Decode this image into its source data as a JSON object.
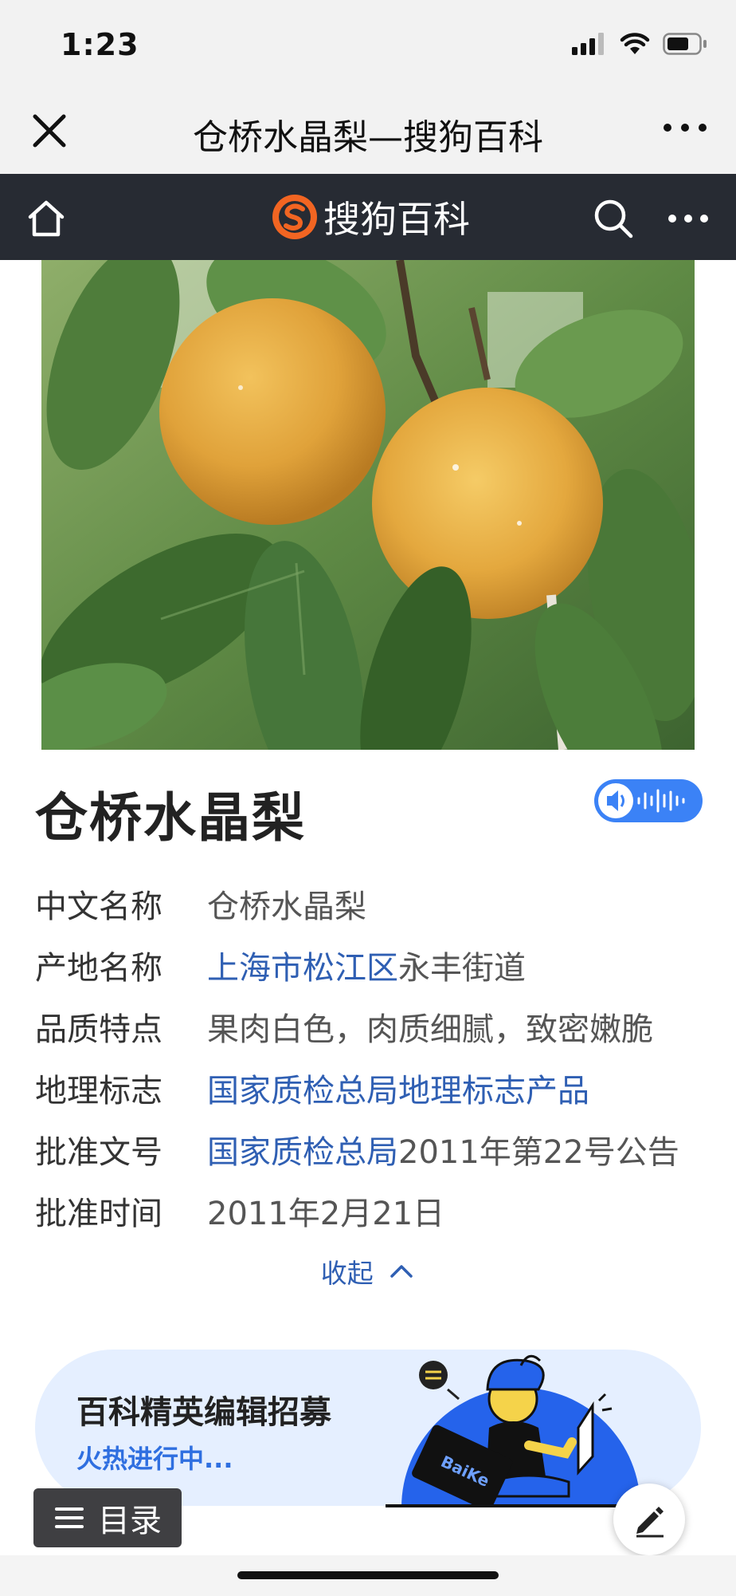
{
  "status_bar": {
    "time": "1:23",
    "icons": [
      "signal-icon",
      "wifi-icon",
      "battery-icon"
    ]
  },
  "wechat_bar": {
    "title": "仓桥水晶梨—搜狗百科",
    "icons": [
      "close-icon",
      "more-icon"
    ]
  },
  "site_nav": {
    "brand": "搜狗百科",
    "icons": [
      "home-icon",
      "sogou-logo-icon",
      "search-icon",
      "more-icon"
    ]
  },
  "entry": {
    "title": "仓桥水晶梨",
    "info": [
      {
        "key": "中文名称",
        "parts": [
          {
            "text": "仓桥水晶梨",
            "link": false
          }
        ]
      },
      {
        "key": "产地名称",
        "parts": [
          {
            "text": "上海市松江区",
            "link": true
          },
          {
            "text": "永丰街道",
            "link": false
          }
        ]
      },
      {
        "key": "品质特点",
        "parts": [
          {
            "text": "果肉白色，肉质细腻，致密嫩脆",
            "link": false
          }
        ]
      },
      {
        "key": "地理标志",
        "parts": [
          {
            "text": "国家质检总局地理标志产品",
            "link": true
          }
        ]
      },
      {
        "key": "批准文号",
        "parts": [
          {
            "text": "国家质检总局",
            "link": true
          },
          {
            "text": "2011年第22号公告",
            "link": false
          }
        ]
      },
      {
        "key": "批准时间",
        "parts": [
          {
            "text": "2011年2月21日",
            "link": false
          }
        ]
      }
    ],
    "collapse_label": "收起"
  },
  "banner": {
    "title": "百科精英编辑招募",
    "subtitle": "火热进行中...",
    "badge_text": "BaiKe"
  },
  "floating": {
    "toc_label": "目录"
  },
  "colors": {
    "nav_bg": "#272b33",
    "brand_orange": "#f26522",
    "link": "#2f5fb3",
    "audio_button": "#3b82f6",
    "banner_bg": "#e5efff"
  }
}
